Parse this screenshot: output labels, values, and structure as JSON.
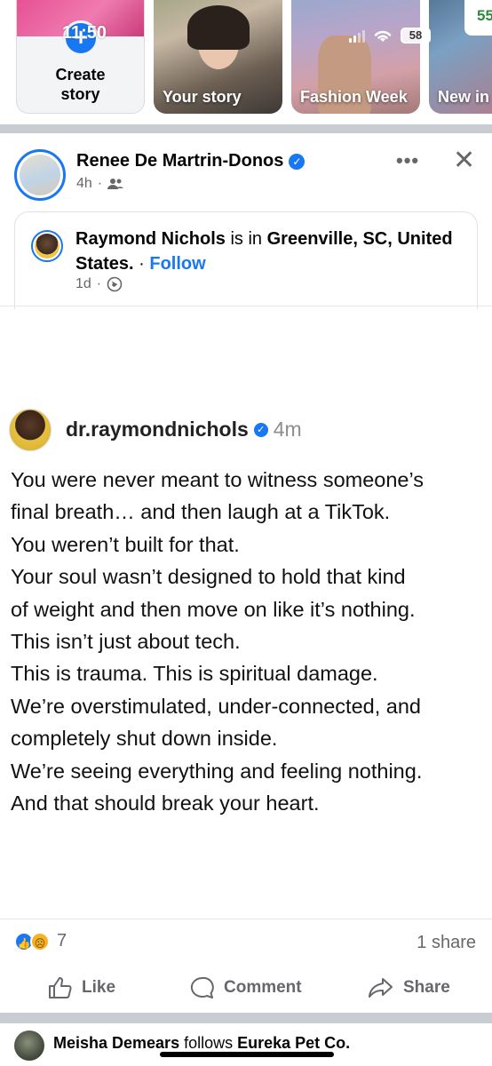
{
  "status_bar": {
    "time": "11:50",
    "battery": "58"
  },
  "stories": {
    "create_label_line1": "Create",
    "create_label_line2": "story",
    "items": [
      {
        "label": "Your story"
      },
      {
        "label": "Fashion Week"
      },
      {
        "label": "New in"
      }
    ],
    "promo_text": "55"
  },
  "post": {
    "author": "Renee De Martrin-Donos",
    "time": "4h",
    "shared": {
      "name": "Raymond Nichols",
      "is_in": " is in ",
      "location": "Greenville, SC, United States.",
      "separator": " · ",
      "follow": "Follow",
      "time": "1d"
    },
    "embedded": {
      "username": "dr.raymondnichols",
      "time": "4m",
      "lines": [
        "You were never meant to witness someone’s",
        "final breath… and then laugh at a TikTok.",
        "You weren’t built for that.",
        "Your soul wasn’t designed to hold that kind",
        "of weight and then move on like it’s nothing.",
        "This isn’t just about tech.",
        "This is trauma. This is spiritual damage.",
        "We’re overstimulated, under-connected, and",
        "completely shut down inside.",
        "We’re seeing everything and feeling nothing.",
        "And that should break your heart."
      ]
    },
    "reactions_count": "7",
    "shares": "1 share",
    "actions": {
      "like": "Like",
      "comment": "Comment",
      "share": "Share"
    }
  },
  "footer": {
    "actor": "Meisha Demears",
    "verb": " follows ",
    "target": "Eureka Pet Co."
  },
  "colors": {
    "accent": "#1877f2",
    "muted": "#65676b"
  }
}
